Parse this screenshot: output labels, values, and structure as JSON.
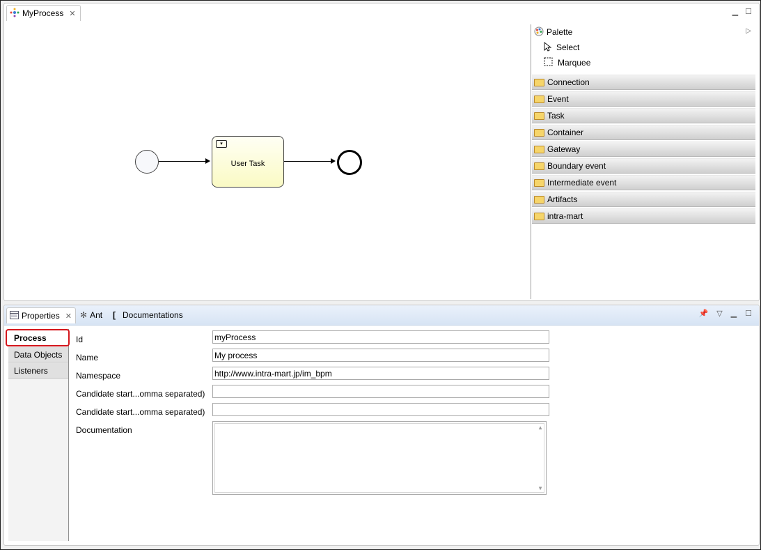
{
  "editor": {
    "tab_title": "MyProcess",
    "diagram": {
      "user_task_label": "User Task"
    }
  },
  "palette": {
    "title": "Palette",
    "tools": [
      {
        "label": "Select",
        "icon": "arrow-cursor-icon"
      },
      {
        "label": "Marquee",
        "icon": "marquee-icon"
      }
    ],
    "drawers": [
      {
        "label": "Connection"
      },
      {
        "label": "Event"
      },
      {
        "label": "Task"
      },
      {
        "label": "Container"
      },
      {
        "label": "Gateway"
      },
      {
        "label": "Boundary event"
      },
      {
        "label": "Intermediate event"
      },
      {
        "label": "Artifacts"
      },
      {
        "label": "intra-mart"
      }
    ]
  },
  "properties_view": {
    "tabs": [
      {
        "label": "Properties"
      },
      {
        "label": "Ant"
      },
      {
        "label": "Documentations"
      }
    ],
    "left_tabs": [
      {
        "label": "Process"
      },
      {
        "label": "Data Objects"
      },
      {
        "label": "Listeners"
      }
    ],
    "form": {
      "id_label": "Id",
      "id_value": "myProcess",
      "name_label": "Name",
      "name_value": "My process",
      "namespace_label": "Namespace",
      "namespace_value": "http://www.intra-mart.jp/im_bpm",
      "candidate1_label": "Candidate start...omma separated)",
      "candidate1_value": "",
      "candidate2_label": "Candidate start...omma separated)",
      "candidate2_value": "",
      "documentation_label": "Documentation",
      "documentation_value": ""
    }
  }
}
